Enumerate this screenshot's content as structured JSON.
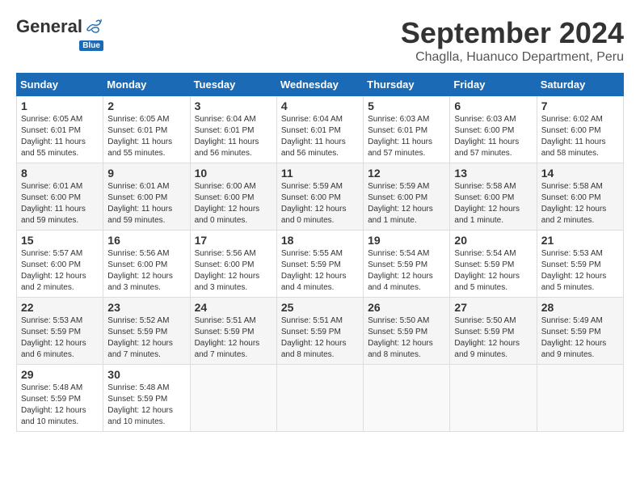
{
  "header": {
    "logo_general": "General",
    "logo_blue": "Blue",
    "month": "September 2024",
    "location": "Chaglla, Huanuco Department, Peru"
  },
  "days_of_week": [
    "Sunday",
    "Monday",
    "Tuesday",
    "Wednesday",
    "Thursday",
    "Friday",
    "Saturday"
  ],
  "weeks": [
    [
      {
        "day": "1",
        "sunrise": "6:05 AM",
        "sunset": "6:01 PM",
        "daylight": "11 hours and 55 minutes."
      },
      {
        "day": "2",
        "sunrise": "6:05 AM",
        "sunset": "6:01 PM",
        "daylight": "11 hours and 55 minutes."
      },
      {
        "day": "3",
        "sunrise": "6:04 AM",
        "sunset": "6:01 PM",
        "daylight": "11 hours and 56 minutes."
      },
      {
        "day": "4",
        "sunrise": "6:04 AM",
        "sunset": "6:01 PM",
        "daylight": "11 hours and 56 minutes."
      },
      {
        "day": "5",
        "sunrise": "6:03 AM",
        "sunset": "6:01 PM",
        "daylight": "11 hours and 57 minutes."
      },
      {
        "day": "6",
        "sunrise": "6:03 AM",
        "sunset": "6:00 PM",
        "daylight": "11 hours and 57 minutes."
      },
      {
        "day": "7",
        "sunrise": "6:02 AM",
        "sunset": "6:00 PM",
        "daylight": "11 hours and 58 minutes."
      }
    ],
    [
      {
        "day": "8",
        "sunrise": "6:01 AM",
        "sunset": "6:00 PM",
        "daylight": "11 hours and 59 minutes."
      },
      {
        "day": "9",
        "sunrise": "6:01 AM",
        "sunset": "6:00 PM",
        "daylight": "11 hours and 59 minutes."
      },
      {
        "day": "10",
        "sunrise": "6:00 AM",
        "sunset": "6:00 PM",
        "daylight": "12 hours and 0 minutes."
      },
      {
        "day": "11",
        "sunrise": "5:59 AM",
        "sunset": "6:00 PM",
        "daylight": "12 hours and 0 minutes."
      },
      {
        "day": "12",
        "sunrise": "5:59 AM",
        "sunset": "6:00 PM",
        "daylight": "12 hours and 1 minute."
      },
      {
        "day": "13",
        "sunrise": "5:58 AM",
        "sunset": "6:00 PM",
        "daylight": "12 hours and 1 minute."
      },
      {
        "day": "14",
        "sunrise": "5:58 AM",
        "sunset": "6:00 PM",
        "daylight": "12 hours and 2 minutes."
      }
    ],
    [
      {
        "day": "15",
        "sunrise": "5:57 AM",
        "sunset": "6:00 PM",
        "daylight": "12 hours and 2 minutes."
      },
      {
        "day": "16",
        "sunrise": "5:56 AM",
        "sunset": "6:00 PM",
        "daylight": "12 hours and 3 minutes."
      },
      {
        "day": "17",
        "sunrise": "5:56 AM",
        "sunset": "6:00 PM",
        "daylight": "12 hours and 3 minutes."
      },
      {
        "day": "18",
        "sunrise": "5:55 AM",
        "sunset": "5:59 PM",
        "daylight": "12 hours and 4 minutes."
      },
      {
        "day": "19",
        "sunrise": "5:54 AM",
        "sunset": "5:59 PM",
        "daylight": "12 hours and 4 minutes."
      },
      {
        "day": "20",
        "sunrise": "5:54 AM",
        "sunset": "5:59 PM",
        "daylight": "12 hours and 5 minutes."
      },
      {
        "day": "21",
        "sunrise": "5:53 AM",
        "sunset": "5:59 PM",
        "daylight": "12 hours and 5 minutes."
      }
    ],
    [
      {
        "day": "22",
        "sunrise": "5:53 AM",
        "sunset": "5:59 PM",
        "daylight": "12 hours and 6 minutes."
      },
      {
        "day": "23",
        "sunrise": "5:52 AM",
        "sunset": "5:59 PM",
        "daylight": "12 hours and 7 minutes."
      },
      {
        "day": "24",
        "sunrise": "5:51 AM",
        "sunset": "5:59 PM",
        "daylight": "12 hours and 7 minutes."
      },
      {
        "day": "25",
        "sunrise": "5:51 AM",
        "sunset": "5:59 PM",
        "daylight": "12 hours and 8 minutes."
      },
      {
        "day": "26",
        "sunrise": "5:50 AM",
        "sunset": "5:59 PM",
        "daylight": "12 hours and 8 minutes."
      },
      {
        "day": "27",
        "sunrise": "5:50 AM",
        "sunset": "5:59 PM",
        "daylight": "12 hours and 9 minutes."
      },
      {
        "day": "28",
        "sunrise": "5:49 AM",
        "sunset": "5:59 PM",
        "daylight": "12 hours and 9 minutes."
      }
    ],
    [
      {
        "day": "29",
        "sunrise": "5:48 AM",
        "sunset": "5:59 PM",
        "daylight": "12 hours and 10 minutes."
      },
      {
        "day": "30",
        "sunrise": "5:48 AM",
        "sunset": "5:59 PM",
        "daylight": "12 hours and 10 minutes."
      },
      null,
      null,
      null,
      null,
      null
    ]
  ]
}
